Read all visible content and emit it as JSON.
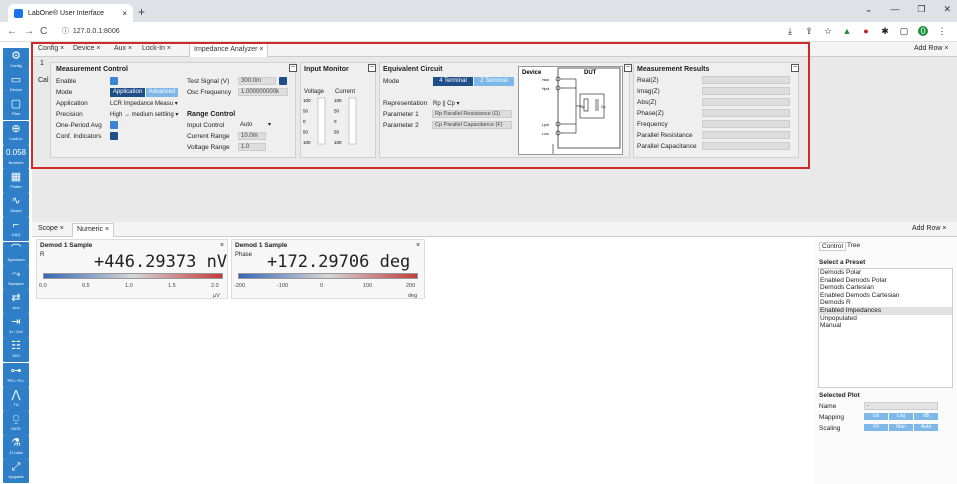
{
  "browser": {
    "tab_title": "LabOne® User Interface",
    "url": "127.0.0.1:8006"
  },
  "sidebar": [
    {
      "label": "Config",
      "icon": "gear-icon",
      "glyph": "⚙"
    },
    {
      "label": "Device",
      "icon": "device-icon",
      "glyph": "▭"
    },
    {
      "label": "Files",
      "icon": "folder-icon",
      "glyph": "▢"
    },
    {
      "label": "Lock-in",
      "icon": "lockin-icon",
      "glyph": "⊕"
    },
    {
      "label": "Numeric",
      "icon": "numeric-icon",
      "glyph": "0.058"
    },
    {
      "label": "Plotter",
      "icon": "plotter-icon",
      "glyph": "▦"
    },
    {
      "label": "Scope",
      "icon": "scope-icon",
      "glyph": "∿"
    },
    {
      "label": "DAQ",
      "icon": "daq-icon",
      "glyph": "⌐"
    },
    {
      "label": "Spectrum",
      "icon": "spectrum-icon",
      "glyph": "⌒"
    },
    {
      "label": "Sweeper",
      "icon": "sweeper-icon",
      "glyph": "⤳"
    },
    {
      "label": "Aux",
      "icon": "aux-icon",
      "glyph": "⇄"
    },
    {
      "label": "In / Out",
      "icon": "inout-icon",
      "glyph": "⇥"
    },
    {
      "label": "DIO",
      "icon": "dio-icon",
      "glyph": "☷"
    },
    {
      "label": "PID / PLL",
      "icon": "pid-icon",
      "glyph": "⊶"
    },
    {
      "label": "TU",
      "icon": "tu-icon",
      "glyph": "⋀"
    },
    {
      "label": "MOD",
      "icon": "mod-icon",
      "glyph": "⍜"
    },
    {
      "label": "ZI Labs",
      "icon": "flask-icon",
      "glyph": "⚗"
    },
    {
      "label": "Upgrade",
      "icon": "upgrade-icon",
      "glyph": "⤢"
    }
  ],
  "top_tabs": [
    "Config",
    "Device",
    "Aux",
    "Lock-In",
    "Impedance Analyzer"
  ],
  "add_row": "Add Row",
  "row_id": "1",
  "cal_label": "Cal",
  "measurement_control": {
    "title": "Measurement Control",
    "enable": "Enable",
    "mode": "Mode",
    "mode_btn1": "Application",
    "mode_btn2": "Advanced",
    "application": "Application",
    "application_val": "LCR Impedance Measu ▾",
    "precision": "Precision",
    "precision_val": "High → medium settling ▾",
    "one_period": "One-Period Avg",
    "conf_ind": "Conf. Indicators"
  },
  "signal": {
    "test_signal": "Test Signal (V)",
    "test_signal_val": "300.0m",
    "osc_freq": "Osc Frequency",
    "osc_freq_val": "1.000000000k"
  },
  "range_control": {
    "title": "Range Control",
    "input_control": "Input Control",
    "input_control_val": "Auto",
    "current_range": "Current Range",
    "current_range_val": "10.0m",
    "voltage_range": "Voltage Range",
    "voltage_range_val": "1.0"
  },
  "input_monitor": {
    "title": "Input Monitor",
    "voltage": "Voltage",
    "current": "Current",
    "ticks_v": [
      "100",
      "50",
      "0",
      "50",
      "100"
    ],
    "ticks_c": [
      "100",
      "50",
      "0",
      "50",
      "100"
    ]
  },
  "equivalent": {
    "title": "Equivalent Circuit",
    "mode": "Mode",
    "btn1": "4 Terminal",
    "btn2": "2 Terminal",
    "representation": "Representation",
    "representation_val": "Rp || Cp ▾",
    "param1": "Parameter 1",
    "param1_val": "Rp Parallel Resistance (Ω)",
    "param2": "Parameter 2",
    "param2_val": "Cp Parallel Capacitance (F)"
  },
  "circuit": {
    "device": "Device",
    "dut": "DUT",
    "labels": [
      "Hcur",
      "Hpot",
      "Lpot",
      "Lcur"
    ],
    "rp": "Rp",
    "cp": "Cp"
  },
  "results": {
    "title": "Measurement Results",
    "rows": [
      "Real(Z)",
      "Imag(Z)",
      "Abs(Z)",
      "Phase(Z)",
      "Frequency",
      "Parallel Resistance",
      "Parallel Capacitance"
    ]
  },
  "lower_tabs": [
    "Scope",
    "Numeric"
  ],
  "numeric1": {
    "title": "Demod 1 Sample",
    "sub": "R",
    "value": "+446.29373 nV",
    "ticks": [
      "0.0",
      "0.5",
      "1.0",
      "1.5",
      "2.0"
    ],
    "unit": "µV"
  },
  "numeric2": {
    "title": "Demod 1 Sample",
    "sub": "Phase",
    "value": "+172.29706 deg",
    "ticks": [
      "-200",
      "-100",
      "0",
      "100",
      "200"
    ],
    "unit": "deg"
  },
  "right_tabs": [
    "Control",
    "Tree"
  ],
  "preset": {
    "title": "Select a Preset",
    "items": [
      "Demods Polar",
      "Enabled Demods Polar",
      "Demods Cartesian",
      "Enabled Demods Cartesian",
      "Demods R",
      "Enabled Impedances",
      "Unpopulated",
      "Manual"
    ]
  },
  "selected_plot": {
    "title": "Selected Plot",
    "name": "Name",
    "name_val": "-",
    "mapping": "Mapping",
    "mapping_btns": [
      "Lin",
      "Log",
      "dB"
    ],
    "scaling": "Scaling",
    "scaling_btns": [
      "Fit",
      "Man",
      "Auto"
    ]
  }
}
